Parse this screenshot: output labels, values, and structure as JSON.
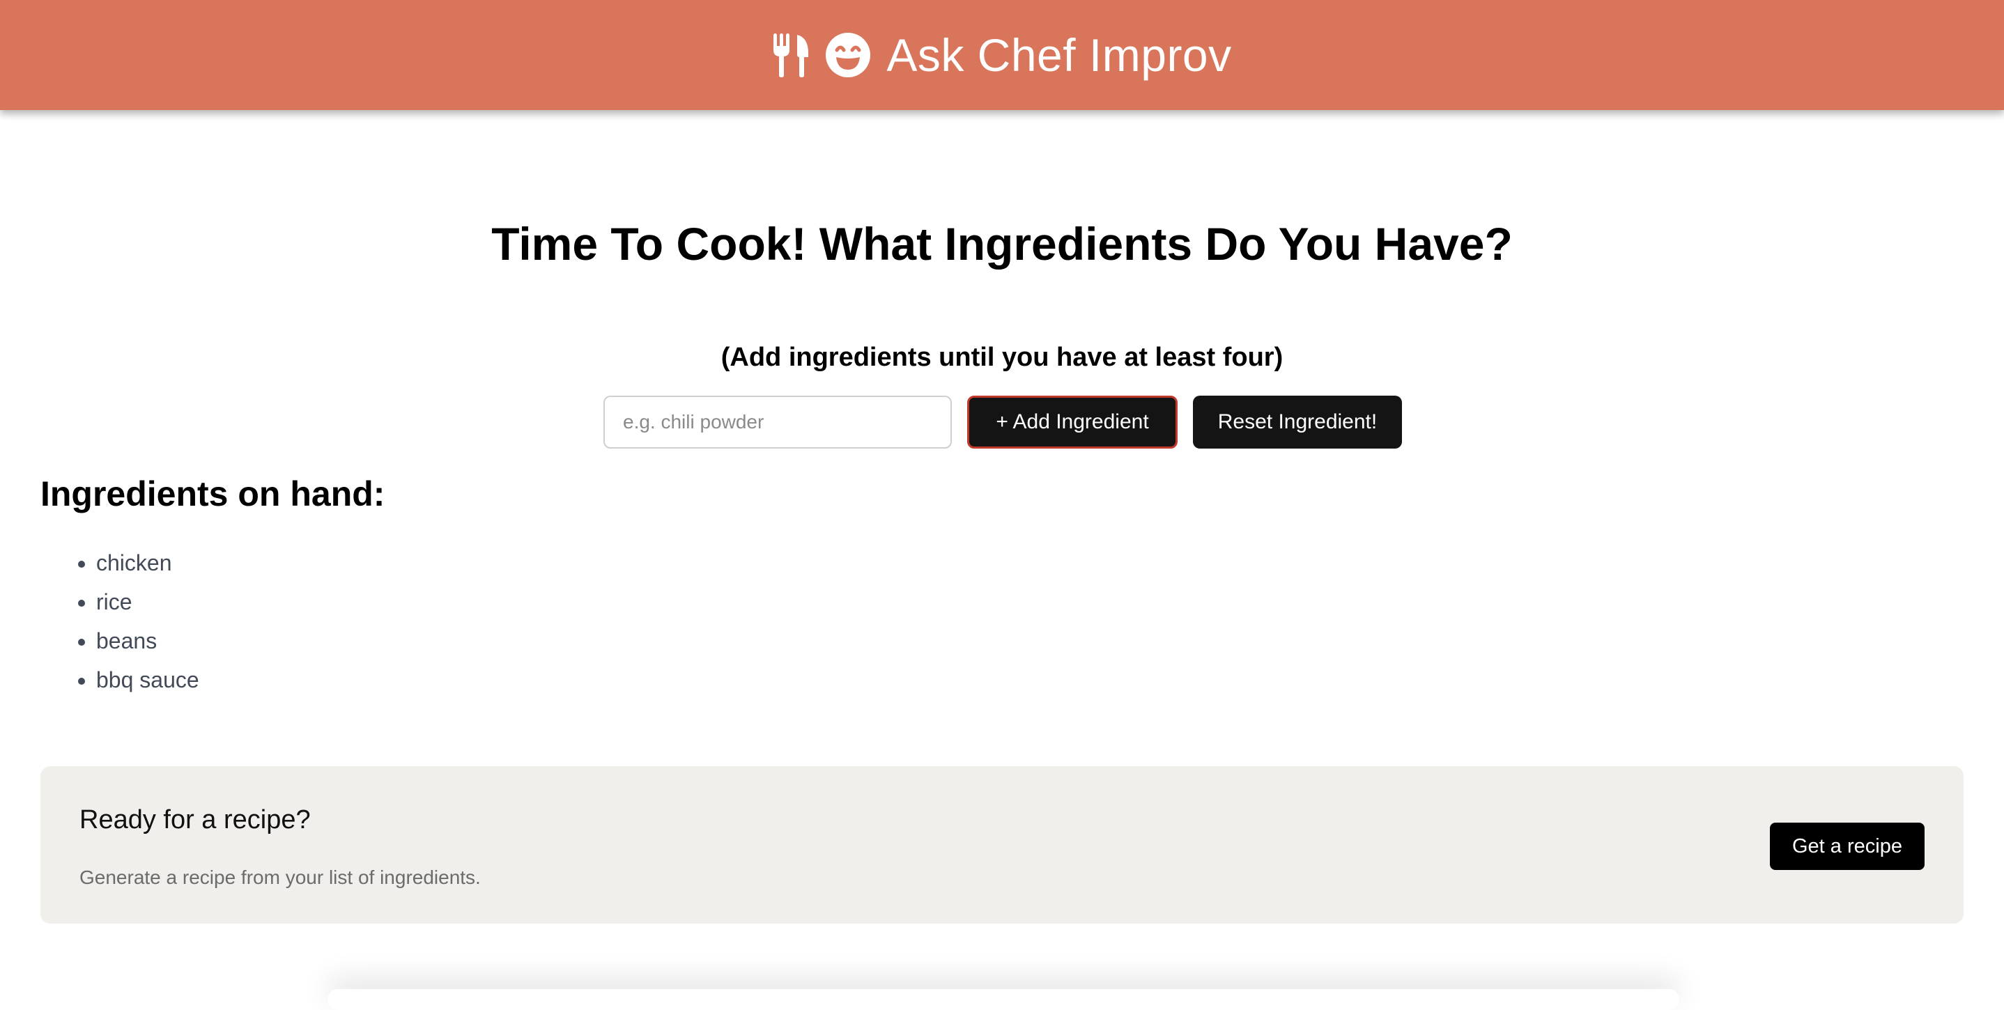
{
  "header": {
    "title": "Ask Chef Improv",
    "icons": [
      "utensils-icon",
      "smile-icon"
    ],
    "background_color": "#d9755a"
  },
  "main": {
    "title": "Time To Cook! What Ingredients Do You Have?",
    "subtitle": "(Add ingredients until you have at least four)"
  },
  "form": {
    "input_placeholder": "e.g. chili powder",
    "input_value": "",
    "add_label": "+ Add Ingredient",
    "reset_label": "Reset Ingredient!"
  },
  "ingredients": {
    "title": "Ingredients on hand:",
    "items": [
      "chicken",
      "rice",
      "beans",
      "bbq sauce"
    ]
  },
  "recipe_card": {
    "heading": "Ready for a recipe?",
    "description": "Generate a recipe from your list of ingredients.",
    "button_label": "Get a recipe",
    "background_color": "#f0efeb"
  }
}
